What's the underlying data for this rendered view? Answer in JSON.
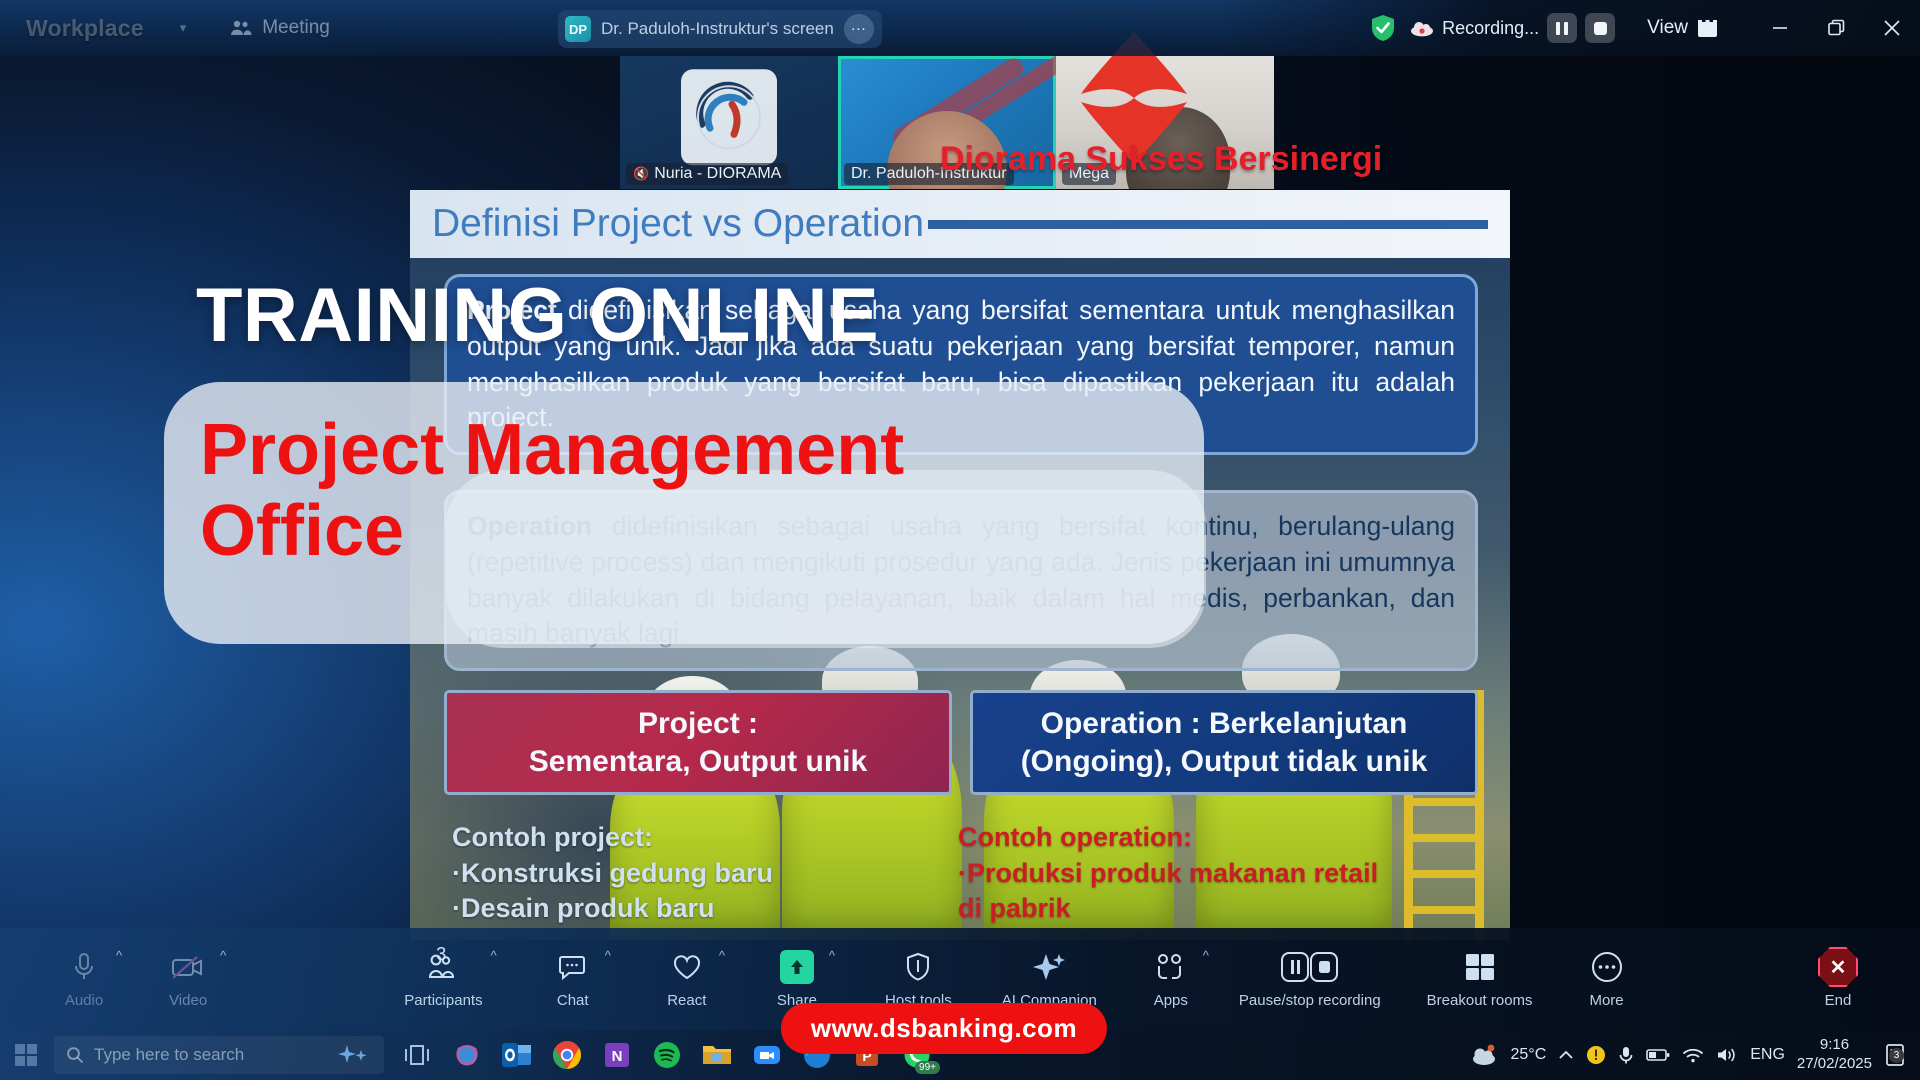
{
  "window": {
    "brand": "Workplace",
    "meeting_label": "Meeting",
    "share_indicator": {
      "avatar_initials": "DP",
      "label": "Dr. Paduloh-Instruktur's screen",
      "more_icon": "ellipsis-icon"
    },
    "recording_label": "Recording...",
    "view_label": "View",
    "minimize_label": "–",
    "restore_label": "❐",
    "close_label": "✕"
  },
  "participants": [
    {
      "name": "Nuria - DIORAMA",
      "muted": true,
      "active": false,
      "tile": "logo"
    },
    {
      "name": "Dr. Paduloh-Instruktur",
      "muted": false,
      "active": true,
      "tile": "speaker"
    },
    {
      "name": "Mega",
      "muted": false,
      "active": false,
      "tile": "camera"
    }
  ],
  "branding": {
    "company_text": "Diorama Sukses Bersinergi",
    "company_color": "#e5202b",
    "overlay_title": "TRAINING ONLINE",
    "overlay_subtitle_line1": "Project Management",
    "overlay_subtitle_line2": "Office",
    "overlay_subtitle_color": "#ee1111",
    "url_banner": "www.dsbanking.com"
  },
  "slide": {
    "title": "Definisi Project vs Operation",
    "definition_project_bold": "Project",
    "definition_project": " didefinisikan sebagai usaha yang bersifat sementara untuk menghasilkan output yang unik. Jadi jika ada suatu pekerjaan yang bersifat temporer, namun menghasilkan produk yang bersifat baru, bisa dipastikan pekerjaan itu adalah project.",
    "definition_operation_bold": "Operation",
    "definition_operation": " didefinisikan sebagai usaha yang  bersifat kontinu, berulang-ulang (repetitive process) dan mengikuti prosedur yang ada. Jenis pekerjaan ini umumnya banyak dilakukan di bidang pelayanan, baik dalam hal medis, perbankan, dan masih banyak lagi.",
    "compare_left_line1": "Project :",
    "compare_left_line2": "Sementara, Output unik",
    "compare_right_line1": "Operation : Berkelanjutan",
    "compare_right_line2": "(Ongoing), Output tidak unik",
    "example_project_title": "Contoh project:",
    "example_project_items": "·Konstruksi gedung baru\n·Desain produk baru",
    "example_operation_title": "Contoh operation:",
    "example_operation_items": "·Produksi produk makanan retail di pabrik\n·Proses akunting",
    "colors": {
      "project_box": "#b5294b",
      "operation_box": "#17418c",
      "title": "#3f7cc0"
    }
  },
  "toolbar": {
    "items": [
      {
        "label": "Audio",
        "icon": "microphone-icon",
        "caret": true,
        "count": ""
      },
      {
        "label": "Video",
        "icon": "camera-off-icon",
        "caret": true,
        "count": ""
      },
      {
        "label": "Participants",
        "icon": "people-icon",
        "caret": true,
        "count": "3"
      },
      {
        "label": "Chat",
        "icon": "chat-icon",
        "caret": true,
        "count": ""
      },
      {
        "label": "React",
        "icon": "heart-icon",
        "caret": true,
        "count": ""
      },
      {
        "label": "Share",
        "icon": "share-screen-icon",
        "caret": true,
        "count": ""
      },
      {
        "label": "Host tools",
        "icon": "shield-icon",
        "caret": false,
        "count": ""
      },
      {
        "label": "AI Companion",
        "icon": "sparkle-icon",
        "caret": false,
        "count": ""
      },
      {
        "label": "Apps",
        "icon": "apps-icon",
        "caret": true,
        "count": ""
      },
      {
        "label": "Pause/stop recording",
        "icon": "pause-stop-recording-icon",
        "caret": false,
        "count": ""
      },
      {
        "label": "Breakout rooms",
        "icon": "grid-icon",
        "caret": false,
        "count": ""
      },
      {
        "label": "More",
        "icon": "ellipsis-circle-icon",
        "caret": false,
        "count": ""
      }
    ],
    "end_label": "End"
  },
  "taskbar": {
    "search_placeholder": "Type here to search",
    "apps": [
      {
        "name": "task-view-icon"
      },
      {
        "name": "copilot-icon"
      },
      {
        "name": "outlook-icon"
      },
      {
        "name": "chrome-icon"
      },
      {
        "name": "onenote-icon"
      },
      {
        "name": "spotify-icon"
      },
      {
        "name": "file-explorer-icon"
      },
      {
        "name": "zoom-icon"
      },
      {
        "name": "edge-icon"
      },
      {
        "name": "powerpoint-icon"
      },
      {
        "name": "whatsapp-icon",
        "badge": "99+"
      }
    ],
    "weather": "25°C",
    "language": "ENG",
    "time": "9:16",
    "date": "27/02/2025",
    "notification_count": "3"
  }
}
